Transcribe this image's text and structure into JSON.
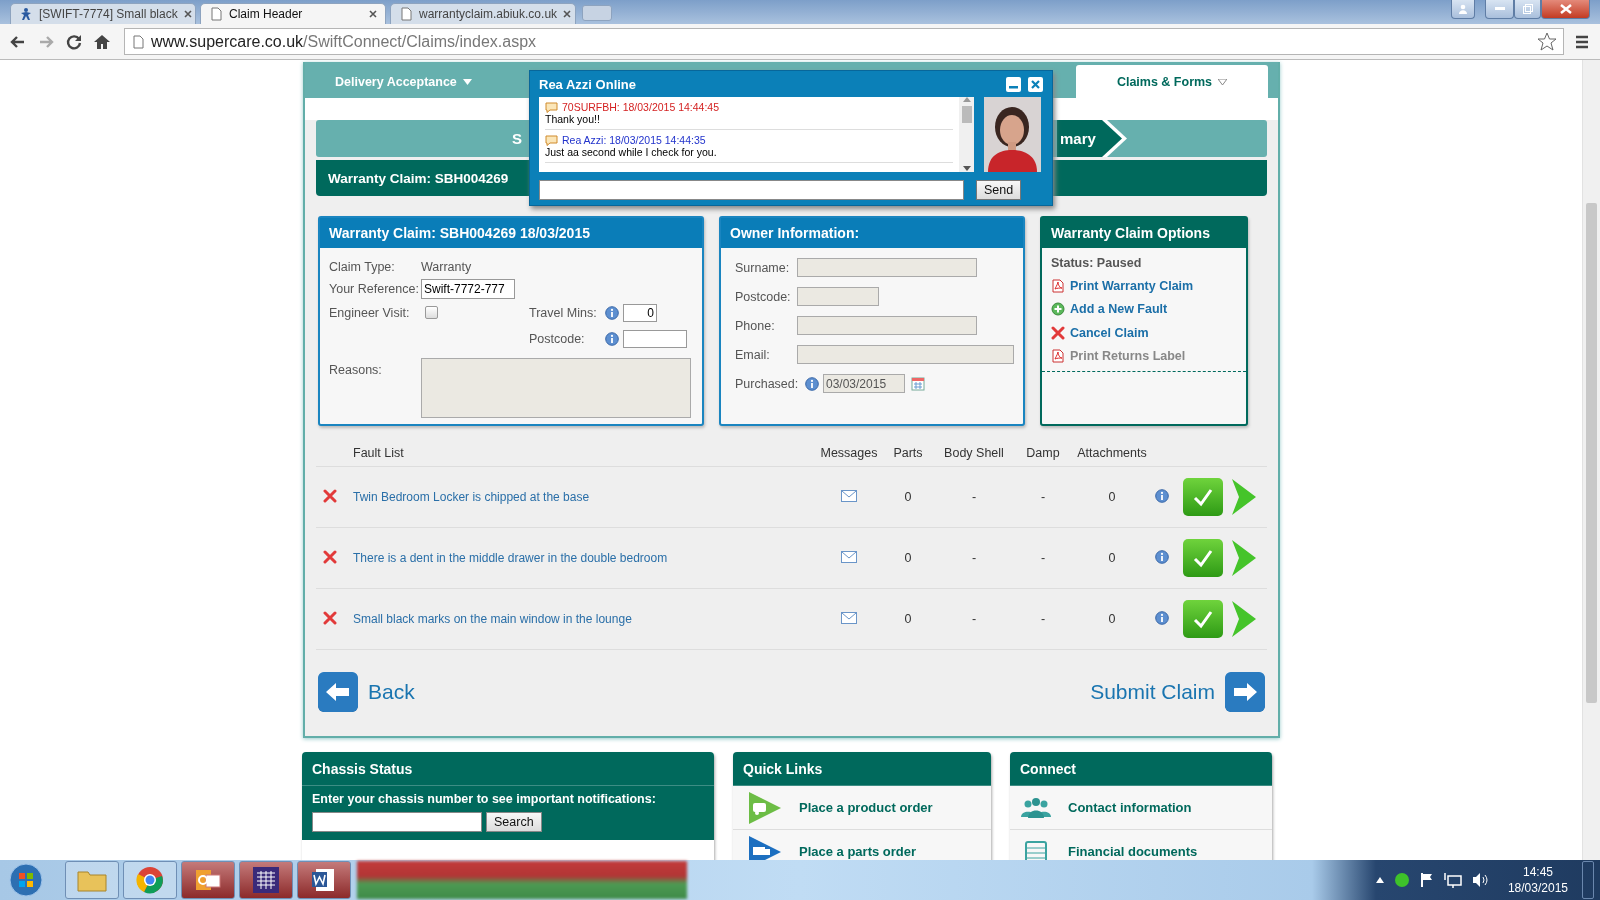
{
  "browser": {
    "tabs": [
      {
        "title": "[SWIFT-7774] Small black",
        "kind": "jira",
        "selected": false
      },
      {
        "title": "Claim Header",
        "kind": "page",
        "selected": true
      },
      {
        "title": "warrantyclaim.abiuk.co.uk",
        "kind": "page",
        "selected": false
      }
    ],
    "url_host": "www.supercare.co.uk",
    "url_path": "/SwiftConnect/Claims/index.aspx"
  },
  "nav": {
    "items": [
      {
        "label": "Delivery Acceptance",
        "selected": false
      },
      {
        "label": "Claims & Forms",
        "selected": true
      }
    ]
  },
  "steps": {
    "first": "S",
    "last": "mary"
  },
  "claim_bar": "Warranty Claim: SBH004269",
  "chat": {
    "title": "Rea Azzi Online",
    "messages": [
      {
        "sender": "70SURFBH: 18/03/2015 14:44:45",
        "text": "Thank you!!",
        "kind": "customer"
      },
      {
        "sender": "Rea Azzi: 18/03/2015 14:44:35",
        "text": "Just aa second while I check for you.",
        "kind": "agent"
      }
    ],
    "send": "Send"
  },
  "claim_panel": {
    "title": "Warranty Claim: SBH004269 18/03/2015",
    "claim_type_label": "Claim Type:",
    "claim_type": "Warranty",
    "reference_label": "Your Reference:",
    "reference": "Swift-7772-777",
    "engineer_label": "Engineer Visit:",
    "engineer_visit": false,
    "travel_label": "Travel Mins:",
    "travel": "0",
    "postcode_label": "Postcode:",
    "reasons_label": "Reasons:"
  },
  "owner_panel": {
    "title": "Owner Information:",
    "fields": [
      {
        "label": "Surname:",
        "kind": "medium"
      },
      {
        "label": "Postcode:",
        "kind": "short"
      },
      {
        "label": "Phone:",
        "kind": "medium"
      },
      {
        "label": "Email:",
        "kind": "long"
      }
    ],
    "purchased_label": "Purchased:",
    "purchased": "03/03/2015"
  },
  "options_panel": {
    "title": "Warranty Claim Options",
    "status": "Status: Paused",
    "links": [
      {
        "label": "Print Warranty Claim",
        "kind": "pdf",
        "disabled": false
      },
      {
        "label": "Add a New Fault",
        "kind": "add",
        "disabled": false
      },
      {
        "label": "Cancel Claim",
        "kind": "cancel",
        "disabled": false
      },
      {
        "label": "Print Returns Label",
        "kind": "pdf",
        "disabled": true
      }
    ]
  },
  "faults": {
    "columns": [
      "Fault List",
      "Messages",
      "Parts",
      "Body Shell",
      "Damp",
      "Attachments"
    ],
    "rows": [
      {
        "description": "Twin Bedroom Locker is chipped at the base",
        "parts": "0",
        "body_shell": "-",
        "damp": "-",
        "attachments": "0"
      },
      {
        "description": "There is a dent in the middle drawer in the double bedroom",
        "parts": "0",
        "body_shell": "-",
        "damp": "-",
        "attachments": "0"
      },
      {
        "description": "Small black marks on the main window in the lounge",
        "parts": "0",
        "body_shell": "-",
        "damp": "-",
        "attachments": "0"
      }
    ]
  },
  "actions": {
    "back": "Back",
    "submit": "Submit Claim"
  },
  "chassis": {
    "title": "Chassis Status",
    "prompt": "Enter your chassis number to see important notifications:",
    "button": "Search"
  },
  "quick_links": {
    "title": "Quick Links",
    "items": [
      {
        "label": "Place a product order",
        "kind": "product"
      },
      {
        "label": "Place a parts order",
        "kind": "parts"
      }
    ]
  },
  "connect": {
    "title": "Connect",
    "items": [
      {
        "label": "Contact information",
        "kind": "contact"
      },
      {
        "label": "Financial documents",
        "kind": "finance"
      }
    ]
  },
  "taskbar": {
    "time": "14:45",
    "date": "18/03/2015"
  }
}
